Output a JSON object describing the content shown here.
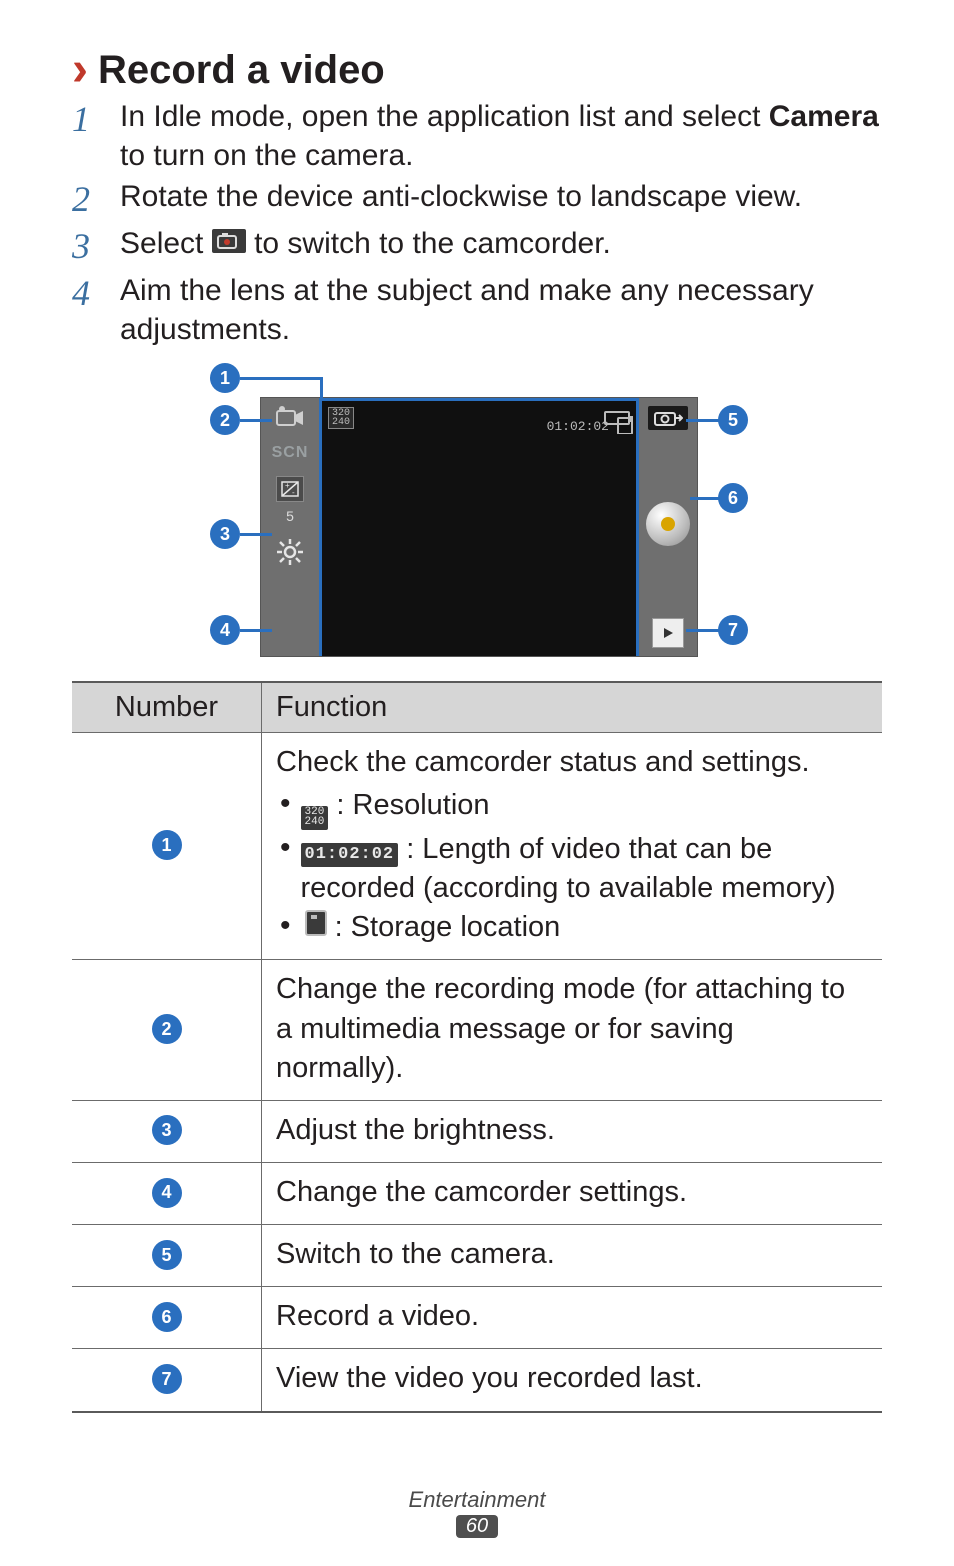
{
  "section": {
    "title": "Record a video"
  },
  "steps": {
    "s1": {
      "num": "1",
      "pre": "In Idle mode, open the application list and select ",
      "bold": "Camera",
      "post": " to turn on the camera."
    },
    "s2": {
      "num": "2",
      "text": "Rotate the device anti-clockwise to landscape view."
    },
    "s3": {
      "num": "3",
      "pre": "Select ",
      "post": " to switch to the camcorder."
    },
    "s4": {
      "num": "4",
      "text": "Aim the lens at the subject and make any necessary adjustments."
    }
  },
  "camui": {
    "resolution": "320\n240",
    "time": "01:02:02",
    "scn": "SCN",
    "brightness_symbol": "⧉",
    "brightness_value": "5"
  },
  "callouts": {
    "c1": "1",
    "c2": "2",
    "c3": "3",
    "c4": "4",
    "c5": "5",
    "c6": "6",
    "c7": "7"
  },
  "table": {
    "head_number": "Number",
    "head_function": "Function",
    "r1": {
      "badge": "1",
      "intro": "Check the camcorder status and settings.",
      "b1_icon": "320\n240",
      "b1_text": " : Resolution",
      "b2_icon": "01:02:02",
      "b2_text": " : Length of video that can be recorded (according to available memory)",
      "b3_text": " : Storage location"
    },
    "r2": {
      "badge": "2",
      "text": "Change the recording mode (for attaching to a multimedia message or for saving normally)."
    },
    "r3": {
      "badge": "3",
      "text": "Adjust the brightness."
    },
    "r4": {
      "badge": "4",
      "text": "Change the camcorder settings."
    },
    "r5": {
      "badge": "5",
      "text": "Switch to the camera."
    },
    "r6": {
      "badge": "6",
      "text": "Record a video."
    },
    "r7": {
      "badge": "7",
      "text": "View the video you recorded last."
    }
  },
  "footer": {
    "section": "Entertainment",
    "page": "60"
  }
}
